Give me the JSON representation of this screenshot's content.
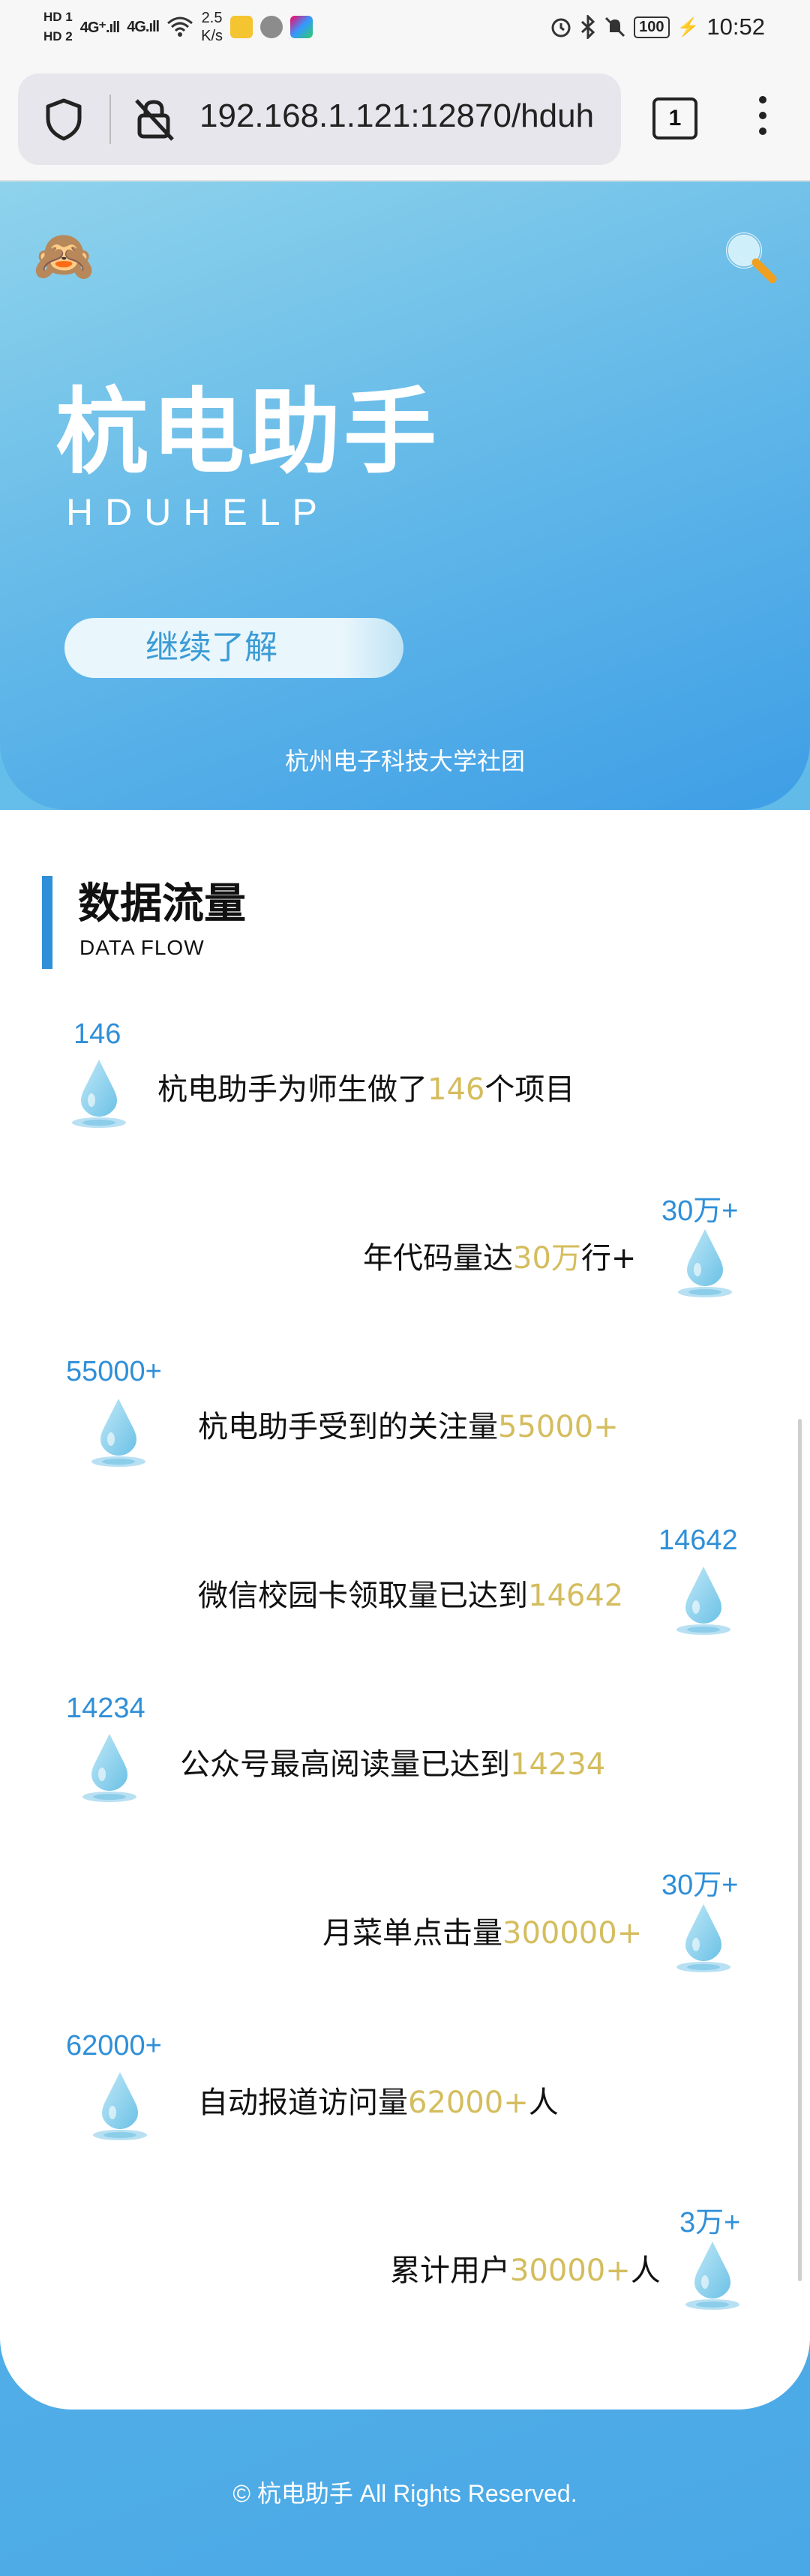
{
  "status_bar": {
    "hd1": "HD 1",
    "hd2": "HD 2",
    "signal1": "4G⁺.ıll",
    "signal2": "4G.ıll",
    "net_speed_value": "2.5",
    "net_speed_unit": "K/s",
    "time": "10:52",
    "battery": "100"
  },
  "browser": {
    "url": "192.168.1.121:12870/hduh",
    "tab_count": "1"
  },
  "hero": {
    "title": "杭电助手",
    "subtitle": "HDUHELP",
    "more_button": "继续了解",
    "org": "杭州电子科技大学社团"
  },
  "section": {
    "title": "数据流量",
    "subtitle": "DATA FLOW"
  },
  "stats": [
    {
      "number": "146",
      "pre": "杭电助手为师生做了",
      "hl": "146",
      "post": "个项目"
    },
    {
      "number": "30万+",
      "pre": "年代码量达",
      "hl": "30万",
      "post": "行+"
    },
    {
      "number": "55000+",
      "pre": "杭电助手受到的关注量",
      "hl": "55000+",
      "post": ""
    },
    {
      "number": "14642",
      "pre": "微信校园卡领取量已达到",
      "hl": "14642",
      "post": ""
    },
    {
      "number": "14234",
      "pre": "公众号最高阅读量已达到",
      "hl": "14234",
      "post": ""
    },
    {
      "number": "30万+",
      "pre": "月菜单点击量",
      "hl": "300000+",
      "post": ""
    },
    {
      "number": "62000+",
      "pre": "自动报道访问量",
      "hl": "62000+",
      "post": "人"
    },
    {
      "number": "3万+",
      "pre": "累计用户",
      "hl": "30000+",
      "post": "人"
    }
  ],
  "footer": "© 杭电助手 All Rights Reserved.",
  "colors": {
    "accent_blue": "#2f8fd8",
    "highlight_gold": "#d4bd5e",
    "hero_gradient_start": "#8fd3ec",
    "hero_gradient_end": "#3e9ee6"
  },
  "icons": {
    "monkey": "see-no-evil-monkey-icon",
    "search": "magnifier-icon",
    "drop": "water-drop-icon"
  }
}
